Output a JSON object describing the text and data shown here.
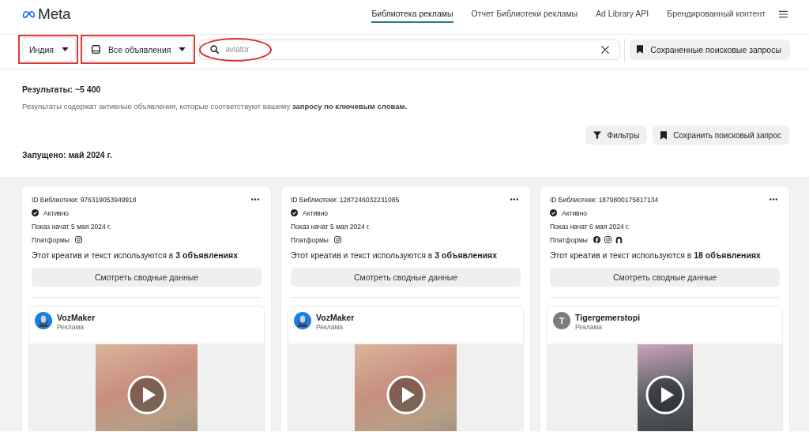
{
  "header": {
    "brand": "Meta",
    "nav": [
      {
        "label": "Библиотека рекламы",
        "selected": true
      },
      {
        "label": "Отчет Библиотеки рекламы",
        "selected": false
      },
      {
        "label": "Ad Library API",
        "selected": false
      },
      {
        "label": "Брендированный контент",
        "selected": false
      }
    ]
  },
  "toolbar": {
    "country": {
      "label": "Индия",
      "highlighted": true
    },
    "ad_type": {
      "label": "Все объявления",
      "highlighted": true
    },
    "search": {
      "value": "aviator",
      "highlighted": true
    },
    "saved_searches": "Сохраненные поисковые запросы"
  },
  "results": {
    "count": "Результаты: ~5 400",
    "note": "Результаты содержат активные объявления, которые соответствуют вашему **запросу по ключевым словам.**",
    "buttons": [
      {
        "kind": "filter",
        "label": "Фильтры"
      },
      {
        "kind": "save",
        "label": "Сохранить поисковый запрос"
      }
    ],
    "group_title": "Запущено: май 2024 г."
  },
  "cards": [
    {
      "library_id": "ID Библиотеки: 976319053949918",
      "status": "Активно",
      "started": "Показ начат 5 мая 2024 г.",
      "platforms_label": "Платформы",
      "platforms": [
        {
          "kind": "instagram"
        }
      ],
      "usage": "Этот креатив и текст используются в **3 объявлениях**",
      "summary_button": "Смотреть сводные данные",
      "advertiser": {
        "name": "VozMaker",
        "avatar": {
          "kind": "logo"
        }
      },
      "sponsored": "Реклама",
      "media": {
        "kind": "video",
        "vertical": false
      }
    },
    {
      "library_id": "ID Библиотеки: 1287246032231085",
      "status": "Активно",
      "started": "Показ начат 5 мая 2024 г.",
      "platforms_label": "Платформы",
      "platforms": [
        {
          "kind": "instagram"
        }
      ],
      "usage": "Этот креатив и текст используются в **3 объявлениях**",
      "summary_button": "Смотреть сводные данные",
      "advertiser": {
        "name": "VozMaker",
        "avatar": {
          "kind": "logo"
        }
      },
      "sponsored": "Реклама",
      "media": {
        "kind": "video",
        "vertical": false
      }
    },
    {
      "library_id": "ID Библиотеки: 1879800175817134",
      "status": "Активно",
      "started": "Показ начат 6 мая 2024 г.",
      "platforms_label": "Платформы",
      "platforms": [
        {
          "kind": "facebook"
        },
        {
          "kind": "instagram"
        },
        {
          "kind": "audience_network"
        }
      ],
      "usage": "Этот креатив и текст используются в **18 объявлениях**",
      "summary_button": "Смотреть сводные данные",
      "advertiser": {
        "name": "Tigergemerstopi",
        "avatar": {
          "kind": "letter",
          "letter": "T"
        }
      },
      "sponsored": "Реклама",
      "media": {
        "kind": "video",
        "vertical": true
      }
    }
  ]
}
